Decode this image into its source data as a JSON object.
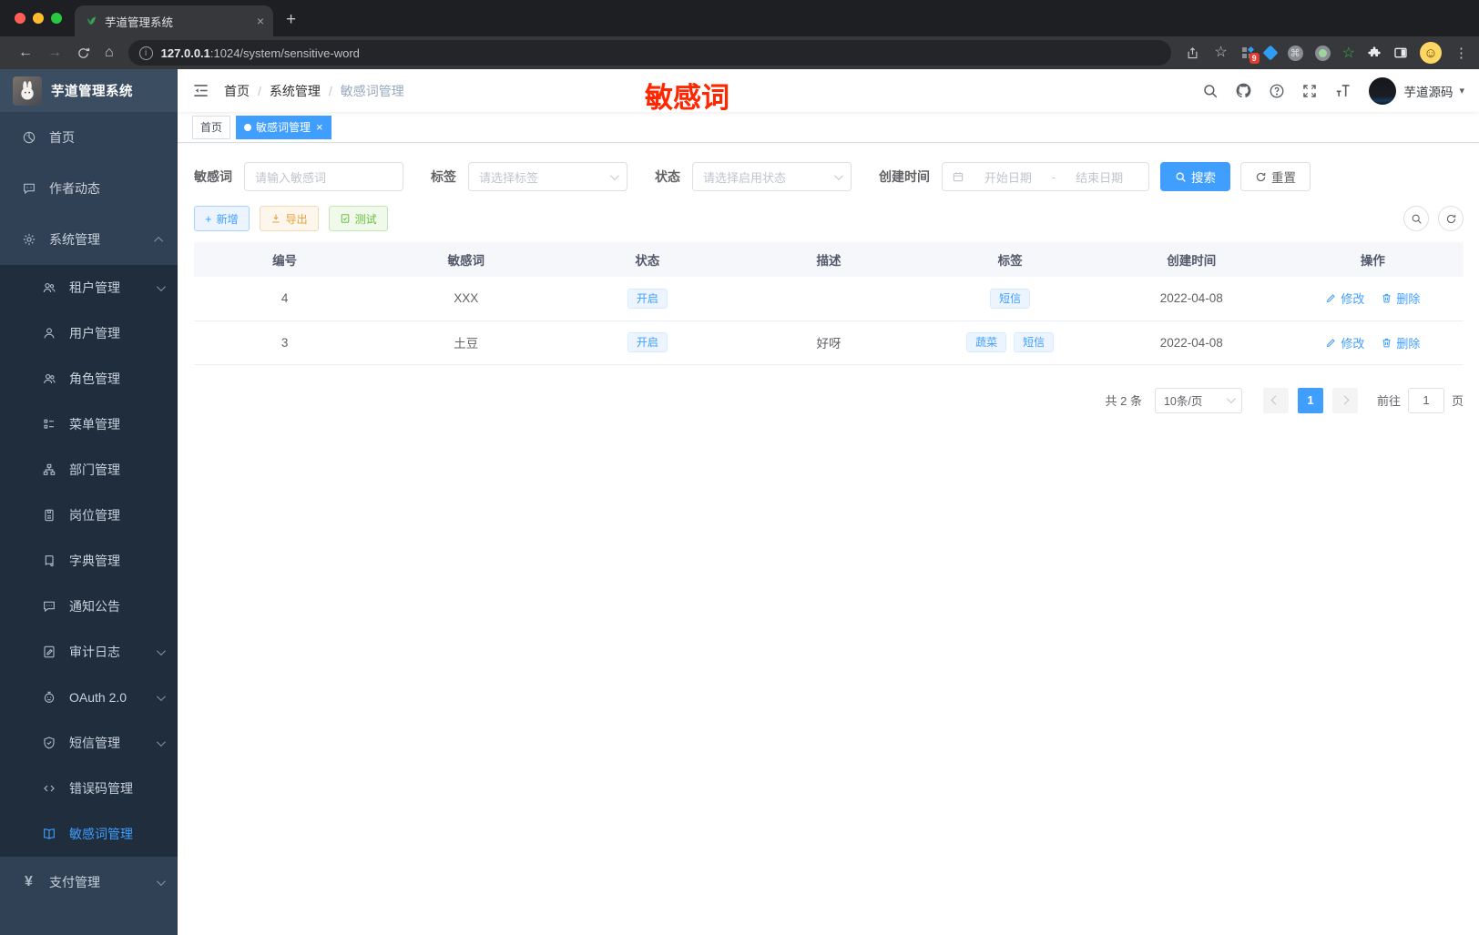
{
  "browser": {
    "tab_title": "芋道管理系统",
    "url_host": "127.0.0.1",
    "url_path": ":1024/system/sensitive-word",
    "extension_badge": "9"
  },
  "icons": {
    "back": "←",
    "forward": "→",
    "home": "⌂",
    "star": "☆",
    "menu_dots": "⋮",
    "command": "⌘",
    "smile": "☺",
    "close": "×",
    "new_tab": "+",
    "plus": "+",
    "yen": "¥",
    "caret_down": "▾"
  },
  "sidebar": {
    "logo_title": "芋道管理系统",
    "items": [
      {
        "label": "首页",
        "icon": "dashboard",
        "level": "top"
      },
      {
        "label": "作者动态",
        "icon": "message",
        "level": "top"
      },
      {
        "label": "系统管理",
        "icon": "gear",
        "level": "top",
        "chevron": "up"
      },
      {
        "label": "租户管理",
        "icon": "users",
        "level": "sub",
        "chevron": "down"
      },
      {
        "label": "用户管理",
        "icon": "user",
        "level": "sub"
      },
      {
        "label": "角色管理",
        "icon": "role",
        "level": "sub"
      },
      {
        "label": "菜单管理",
        "icon": "tree",
        "level": "sub"
      },
      {
        "label": "部门管理",
        "icon": "org",
        "level": "sub"
      },
      {
        "label": "岗位管理",
        "icon": "badge",
        "level": "sub"
      },
      {
        "label": "字典管理",
        "icon": "book",
        "level": "sub"
      },
      {
        "label": "通知公告",
        "icon": "chat",
        "level": "sub"
      },
      {
        "label": "审计日志",
        "icon": "log",
        "level": "sub",
        "chevron": "down"
      },
      {
        "label": "OAuth 2.0",
        "icon": "robot",
        "level": "sub",
        "chevron": "down"
      },
      {
        "label": "短信管理",
        "icon": "shield",
        "level": "sub",
        "chevron": "down"
      },
      {
        "label": "错误码管理",
        "icon": "code",
        "level": "sub"
      },
      {
        "label": "敏感词管理",
        "icon": "openbook",
        "level": "sub",
        "active": true
      },
      {
        "label": "支付管理",
        "icon": "yen",
        "level": "top",
        "chevron": "down"
      }
    ]
  },
  "header": {
    "breadcrumb": [
      "首页",
      "系统管理",
      "敏感词管理"
    ],
    "annotation": "敏感词",
    "annotation_color": "#ff2600",
    "username": "芋道源码"
  },
  "tags_view": {
    "tabs": [
      {
        "label": "首页",
        "active": false
      },
      {
        "label": "敏感词管理",
        "active": true,
        "closable": true
      }
    ]
  },
  "filters": {
    "keyword": {
      "label": "敏感词",
      "placeholder": "请输入敏感词"
    },
    "tag": {
      "label": "标签",
      "placeholder": "请选择标签"
    },
    "status": {
      "label": "状态",
      "placeholder": "请选择启用状态"
    },
    "create_time": {
      "label": "创建时间",
      "start_placeholder": "开始日期",
      "separator": "-",
      "end_placeholder": "结束日期"
    },
    "search_label": "搜索",
    "reset_label": "重置"
  },
  "toolbar": {
    "add_label": "新增",
    "export_label": "导出",
    "test_label": "测试"
  },
  "table": {
    "columns": [
      "编号",
      "敏感词",
      "状态",
      "描述",
      "标签",
      "创建时间",
      "操作"
    ],
    "edit_label": "修改",
    "delete_label": "删除",
    "rows": [
      {
        "id": "4",
        "word": "XXX",
        "status": "开启",
        "description": "",
        "tags": [
          "短信"
        ],
        "create_time": "2022-04-08"
      },
      {
        "id": "3",
        "word": "土豆",
        "status": "开启",
        "description": "好呀",
        "tags": [
          "蔬菜",
          "短信"
        ],
        "create_time": "2022-04-08"
      }
    ]
  },
  "pagination": {
    "total_text": "共 2 条",
    "page_size": "10条/页",
    "current_page": "1",
    "goto_label": "前往",
    "goto_value": "1",
    "page_suffix": "页"
  },
  "colors": {
    "primary": "#409eff",
    "sidebar_bg": "#304156",
    "submenu_bg": "#1f2d3d",
    "warning": "#e6a23c",
    "success": "#67c23a"
  }
}
